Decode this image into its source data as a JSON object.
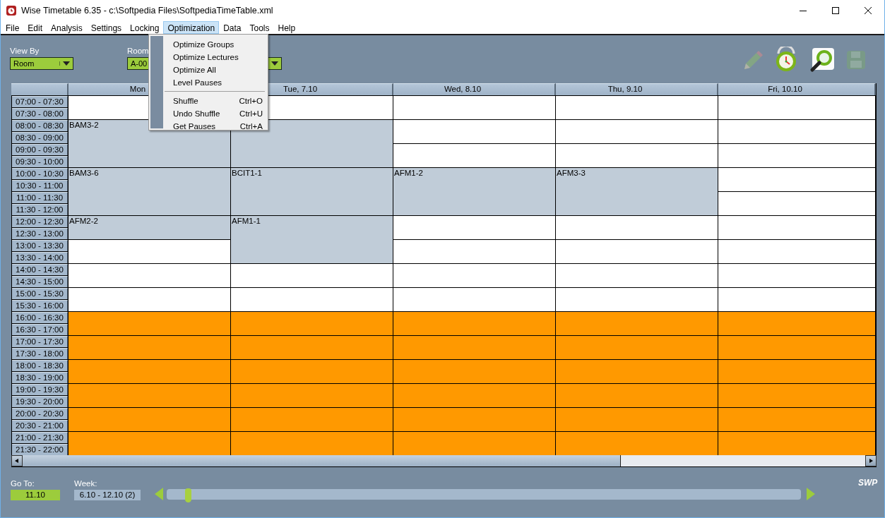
{
  "window": {
    "title": "Wise Timetable 6.35 - c:\\Softpedia Files\\SoftpediaTimeTable.xml"
  },
  "menu_bar": [
    {
      "label": "File",
      "selected": false
    },
    {
      "label": "Edit",
      "selected": false
    },
    {
      "label": "Analysis",
      "selected": false
    },
    {
      "label": "Settings",
      "selected": false
    },
    {
      "label": "Locking",
      "selected": false
    },
    {
      "label": "Optimization",
      "selected": true
    },
    {
      "label": "Data",
      "selected": false
    },
    {
      "label": "Tools",
      "selected": false
    },
    {
      "label": "Help",
      "selected": false
    }
  ],
  "open_menu": {
    "items": [
      {
        "kind": "item",
        "label": "Optimize Groups"
      },
      {
        "kind": "item",
        "label": "Optimize Lectures"
      },
      {
        "kind": "item",
        "label": "Optimize All"
      },
      {
        "kind": "item",
        "label": "Level Pauses"
      },
      {
        "kind": "separator"
      },
      {
        "kind": "item",
        "label": "Shuffle",
        "shortcut": "Ctrl+O"
      },
      {
        "kind": "item",
        "label": "Undo Shuffle",
        "shortcut": "Ctrl+U"
      },
      {
        "kind": "item",
        "label": "Get Pauses",
        "shortcut": "Ctrl+A"
      }
    ]
  },
  "view_by": {
    "label": "View By",
    "value": "Room"
  },
  "room": {
    "label": "Room",
    "value": "A-00"
  },
  "toolbar": [
    {
      "kind": "pencil",
      "disabled": true
    },
    {
      "kind": "clock",
      "disabled": false
    },
    {
      "kind": "search",
      "disabled": false
    },
    {
      "kind": "save",
      "disabled": true
    }
  ],
  "days": [
    "Mon",
    "Tue, 7.10",
    "Wed, 8.10",
    "Thu, 9.10",
    "Fri, 10.10"
  ],
  "rows": [
    {
      "time": "07:00 - 07:30",
      "cells": [
        {
          "kind": "free",
          "joined": false
        },
        {
          "kind": "free",
          "joined": false
        },
        {
          "kind": "free",
          "joined": false
        },
        {
          "kind": "free",
          "joined": false
        },
        {
          "kind": "free",
          "joined": false
        }
      ]
    },
    {
      "time": "07:30 - 08:00",
      "cells": [
        {
          "kind": "free",
          "joined": true
        },
        {
          "kind": "free",
          "joined": true
        },
        {
          "kind": "free",
          "joined": true
        },
        {
          "kind": "free",
          "joined": true
        },
        {
          "kind": "free",
          "joined": true
        }
      ]
    },
    {
      "time": "08:00 - 08:30",
      "cells": [
        {
          "kind": "lecture",
          "joined": false,
          "label": "BAM3-2"
        },
        {
          "kind": "lecture",
          "joined": false
        },
        {
          "kind": "free",
          "joined": false
        },
        {
          "kind": "free",
          "joined": false
        },
        {
          "kind": "free",
          "joined": false
        }
      ]
    },
    {
      "time": "08:30 - 09:00",
      "cells": [
        {
          "kind": "lecture",
          "joined": true
        },
        {
          "kind": "lecture",
          "joined": true
        },
        {
          "kind": "free",
          "joined": true
        },
        {
          "kind": "free",
          "joined": true
        },
        {
          "kind": "free",
          "joined": true
        }
      ]
    },
    {
      "time": "09:00 - 09:30",
      "cells": [
        {
          "kind": "lecture",
          "joined": true
        },
        {
          "kind": "lecture",
          "joined": true
        },
        {
          "kind": "free",
          "joined": false
        },
        {
          "kind": "free",
          "joined": false
        },
        {
          "kind": "free",
          "joined": false
        }
      ]
    },
    {
      "time": "09:30 - 10:00",
      "cells": [
        {
          "kind": "lecture",
          "joined": true
        },
        {
          "kind": "lecture",
          "joined": true
        },
        {
          "kind": "free",
          "joined": true
        },
        {
          "kind": "free",
          "joined": true
        },
        {
          "kind": "free",
          "joined": true
        }
      ]
    },
    {
      "time": "10:00 - 10:30",
      "cells": [
        {
          "kind": "lecture",
          "joined": false,
          "label": "BAM3-6"
        },
        {
          "kind": "lecture",
          "joined": false,
          "label": "BCIT1-1"
        },
        {
          "kind": "lecture",
          "joined": false,
          "label": "AFM1-2"
        },
        {
          "kind": "lecture",
          "joined": false,
          "label": "AFM3-3"
        },
        {
          "kind": "free",
          "joined": false
        }
      ]
    },
    {
      "time": "10:30 - 11:00",
      "cells": [
        {
          "kind": "lecture",
          "joined": true
        },
        {
          "kind": "lecture",
          "joined": true
        },
        {
          "kind": "lecture",
          "joined": true
        },
        {
          "kind": "lecture",
          "joined": true
        },
        {
          "kind": "free",
          "joined": true
        }
      ]
    },
    {
      "time": "11:00 - 11:30",
      "cells": [
        {
          "kind": "lecture",
          "joined": true
        },
        {
          "kind": "lecture",
          "joined": true
        },
        {
          "kind": "lecture",
          "joined": true
        },
        {
          "kind": "lecture",
          "joined": true
        },
        {
          "kind": "free",
          "joined": false
        }
      ]
    },
    {
      "time": "11:30 - 12:00",
      "cells": [
        {
          "kind": "lecture",
          "joined": true
        },
        {
          "kind": "lecture",
          "joined": true
        },
        {
          "kind": "lecture",
          "joined": true
        },
        {
          "kind": "lecture",
          "joined": true
        },
        {
          "kind": "free",
          "joined": true
        }
      ]
    },
    {
      "time": "12:00 - 12:30",
      "cells": [
        {
          "kind": "lecture",
          "joined": false,
          "label": "AFM2-2"
        },
        {
          "kind": "lecture",
          "joined": false,
          "label": "AFM1-1"
        },
        {
          "kind": "free",
          "joined": false
        },
        {
          "kind": "free",
          "joined": false
        },
        {
          "kind": "free",
          "joined": false
        }
      ]
    },
    {
      "time": "12:30 - 13:00",
      "cells": [
        {
          "kind": "lecture",
          "joined": true
        },
        {
          "kind": "lecture",
          "joined": true
        },
        {
          "kind": "free",
          "joined": true
        },
        {
          "kind": "free",
          "joined": true
        },
        {
          "kind": "free",
          "joined": true
        }
      ]
    },
    {
      "time": "13:00 - 13:30",
      "cells": [
        {
          "kind": "free",
          "joined": false
        },
        {
          "kind": "lecture",
          "joined": true
        },
        {
          "kind": "free",
          "joined": false
        },
        {
          "kind": "free",
          "joined": false
        },
        {
          "kind": "free",
          "joined": false
        }
      ]
    },
    {
      "time": "13:30 - 14:00",
      "cells": [
        {
          "kind": "free",
          "joined": true
        },
        {
          "kind": "lecture",
          "joined": true
        },
        {
          "kind": "free",
          "joined": true
        },
        {
          "kind": "free",
          "joined": true
        },
        {
          "kind": "free",
          "joined": true
        }
      ]
    },
    {
      "time": "14:00 - 14:30",
      "cells": [
        {
          "kind": "free",
          "joined": false
        },
        {
          "kind": "free",
          "joined": false
        },
        {
          "kind": "free",
          "joined": false
        },
        {
          "kind": "free",
          "joined": false
        },
        {
          "kind": "free",
          "joined": false
        }
      ]
    },
    {
      "time": "14:30 - 15:00",
      "cells": [
        {
          "kind": "free",
          "joined": true
        },
        {
          "kind": "free",
          "joined": true
        },
        {
          "kind": "free",
          "joined": true
        },
        {
          "kind": "free",
          "joined": true
        },
        {
          "kind": "free",
          "joined": true
        }
      ]
    },
    {
      "time": "15:00 - 15:30",
      "cells": [
        {
          "kind": "free",
          "joined": false
        },
        {
          "kind": "free",
          "joined": false
        },
        {
          "kind": "free",
          "joined": false
        },
        {
          "kind": "free",
          "joined": false
        },
        {
          "kind": "free",
          "joined": false
        }
      ]
    },
    {
      "time": "15:30 - 16:00",
      "cells": [
        {
          "kind": "free",
          "joined": true
        },
        {
          "kind": "free",
          "joined": true
        },
        {
          "kind": "free",
          "joined": true
        },
        {
          "kind": "free",
          "joined": true
        },
        {
          "kind": "free",
          "joined": true
        }
      ]
    },
    {
      "time": "16:00 - 16:30",
      "cells": [
        {
          "kind": "unavailable",
          "joined": false
        },
        {
          "kind": "unavailable",
          "joined": false
        },
        {
          "kind": "unavailable",
          "joined": false
        },
        {
          "kind": "unavailable",
          "joined": false
        },
        {
          "kind": "unavailable",
          "joined": false
        }
      ]
    },
    {
      "time": "16:30 - 17:00",
      "cells": [
        {
          "kind": "unavailable",
          "joined": true
        },
        {
          "kind": "unavailable",
          "joined": true
        },
        {
          "kind": "unavailable",
          "joined": true
        },
        {
          "kind": "unavailable",
          "joined": true
        },
        {
          "kind": "unavailable",
          "joined": true
        }
      ]
    },
    {
      "time": "17:00 - 17:30",
      "cells": [
        {
          "kind": "unavailable",
          "joined": false
        },
        {
          "kind": "unavailable",
          "joined": false
        },
        {
          "kind": "unavailable",
          "joined": false
        },
        {
          "kind": "unavailable",
          "joined": false
        },
        {
          "kind": "unavailable",
          "joined": false
        }
      ]
    },
    {
      "time": "17:30 - 18:00",
      "cells": [
        {
          "kind": "unavailable",
          "joined": true
        },
        {
          "kind": "unavailable",
          "joined": true
        },
        {
          "kind": "unavailable",
          "joined": true
        },
        {
          "kind": "unavailable",
          "joined": true
        },
        {
          "kind": "unavailable",
          "joined": true
        }
      ]
    },
    {
      "time": "18:00 - 18:30",
      "cells": [
        {
          "kind": "unavailable",
          "joined": false
        },
        {
          "kind": "unavailable",
          "joined": false
        },
        {
          "kind": "unavailable",
          "joined": false
        },
        {
          "kind": "unavailable",
          "joined": false
        },
        {
          "kind": "unavailable",
          "joined": false
        }
      ]
    },
    {
      "time": "18:30 - 19:00",
      "cells": [
        {
          "kind": "unavailable",
          "joined": true
        },
        {
          "kind": "unavailable",
          "joined": true
        },
        {
          "kind": "unavailable",
          "joined": true
        },
        {
          "kind": "unavailable",
          "joined": true
        },
        {
          "kind": "unavailable",
          "joined": true
        }
      ]
    },
    {
      "time": "19:00 - 19:30",
      "cells": [
        {
          "kind": "unavailable",
          "joined": false
        },
        {
          "kind": "unavailable",
          "joined": false
        },
        {
          "kind": "unavailable",
          "joined": false
        },
        {
          "kind": "unavailable",
          "joined": false
        },
        {
          "kind": "unavailable",
          "joined": false
        }
      ]
    },
    {
      "time": "19:30 - 20:00",
      "cells": [
        {
          "kind": "unavailable",
          "joined": true
        },
        {
          "kind": "unavailable",
          "joined": true
        },
        {
          "kind": "unavailable",
          "joined": true
        },
        {
          "kind": "unavailable",
          "joined": true
        },
        {
          "kind": "unavailable",
          "joined": true
        }
      ]
    },
    {
      "time": "20:00 - 20:30",
      "cells": [
        {
          "kind": "unavailable",
          "joined": false
        },
        {
          "kind": "unavailable",
          "joined": false
        },
        {
          "kind": "unavailable",
          "joined": false
        },
        {
          "kind": "unavailable",
          "joined": false
        },
        {
          "kind": "unavailable",
          "joined": false
        }
      ]
    },
    {
      "time": "20:30 - 21:00",
      "cells": [
        {
          "kind": "unavailable",
          "joined": true
        },
        {
          "kind": "unavailable",
          "joined": true
        },
        {
          "kind": "unavailable",
          "joined": true
        },
        {
          "kind": "unavailable",
          "joined": true
        },
        {
          "kind": "unavailable",
          "joined": true
        }
      ]
    },
    {
      "time": "21:00 - 21:30",
      "cells": [
        {
          "kind": "unavailable",
          "joined": false
        },
        {
          "kind": "unavailable",
          "joined": false
        },
        {
          "kind": "unavailable",
          "joined": false
        },
        {
          "kind": "unavailable",
          "joined": false
        },
        {
          "kind": "unavailable",
          "joined": false
        }
      ]
    },
    {
      "time": "21:30 - 22:00",
      "cells": [
        {
          "kind": "unavailable",
          "joined": true
        },
        {
          "kind": "unavailable",
          "joined": true
        },
        {
          "kind": "unavailable",
          "joined": true
        },
        {
          "kind": "unavailable",
          "joined": true
        },
        {
          "kind": "unavailable",
          "joined": true
        }
      ]
    }
  ],
  "go_to": {
    "label": "Go To:",
    "value": "11.10"
  },
  "week": {
    "label": "Week:",
    "value": "6.10 - 12.10  (2)",
    "level": 0.02
  },
  "brand": "SWP"
}
